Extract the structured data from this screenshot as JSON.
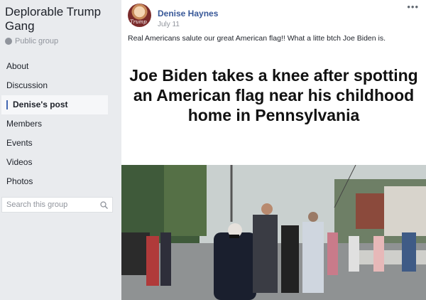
{
  "sidebar": {
    "group_name": "Deplorable Trump Gang",
    "privacy": "Public group",
    "nav": [
      {
        "label": "About"
      },
      {
        "label": "Discussion"
      },
      {
        "label": "Denise's post",
        "active": true
      },
      {
        "label": "Members"
      },
      {
        "label": "Events"
      },
      {
        "label": "Videos"
      },
      {
        "label": "Photos"
      }
    ],
    "search_placeholder": "Search this group"
  },
  "post": {
    "author": "Denise Haynes",
    "date": "July 11",
    "avatar_caption": "Trump",
    "text": "Real Americans salute our great American flag!! What a litte btch Joe Biden is.",
    "headline": "Joe Biden takes a knee after spotting an American flag near his childhood home in Pennsylvania",
    "more_icon": "ellipsis-icon"
  },
  "colors": {
    "link_blue": "#385898",
    "accent": "#4267b2",
    "background": "#e9ebee"
  }
}
